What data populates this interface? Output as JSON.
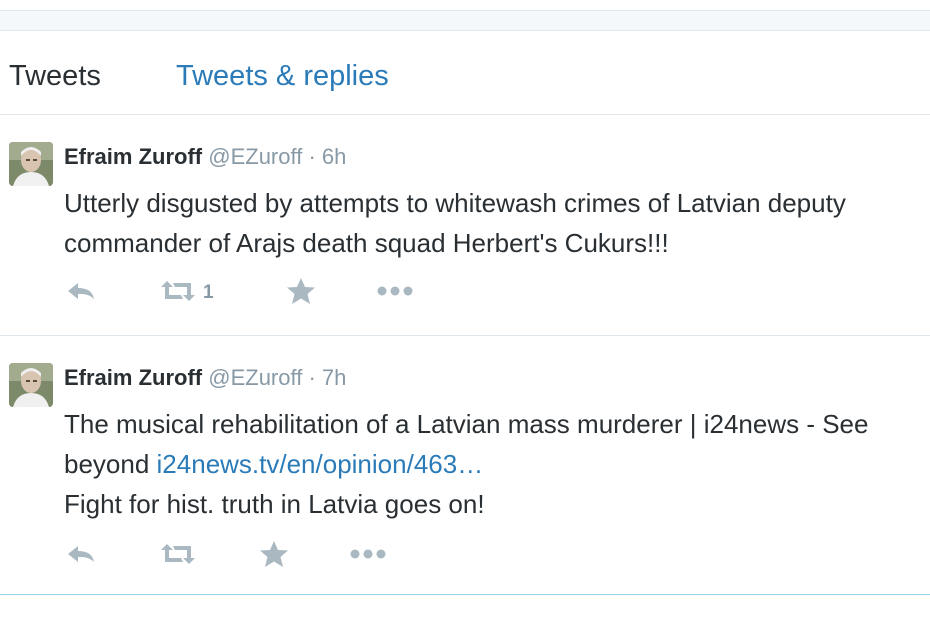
{
  "tabs": {
    "tweets": "Tweets",
    "tweets_replies": "Tweets & replies"
  },
  "tweets": [
    {
      "name": "Efraim Zuroff",
      "handle": "@EZuroff",
      "separator": "·",
      "time": "6h",
      "lines": [
        "Utterly disgusted by attempts to whitewash crimes of Latvian deputy",
        "commander of Arajs death squad Herbert's Cukurs!!!"
      ],
      "retweet_count": "1"
    },
    {
      "name": "Efraim Zuroff",
      "handle": "@EZuroff",
      "separator": "·",
      "time": "7h",
      "line1": "The musical rehabilitation of a Latvian mass murderer | i24news - See",
      "line2_prefix": "beyond ",
      "line2_link": "i24news.tv/en/opinion/463…",
      "line3": "Fight for hist. truth in Latvia goes on!",
      "retweet_count": ""
    }
  ],
  "icons": {
    "reply": "reply-icon",
    "retweet": "retweet-icon",
    "favorite": "star-icon",
    "more": "more-icon"
  },
  "colors": {
    "link": "#2b7bb9",
    "text": "#292f33",
    "muted": "#8899a6",
    "icon": "#aab8c2"
  }
}
